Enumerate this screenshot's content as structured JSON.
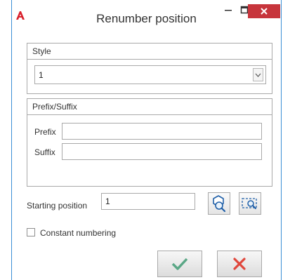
{
  "window": {
    "title": "Renumber position",
    "app_icon": "autocad-logo-icon",
    "controls": [
      "minimize-icon",
      "maximize-icon",
      "close-icon"
    ],
    "close_color": "#c7353c"
  },
  "style_group": {
    "header": "Style",
    "selected_value": "1"
  },
  "prefix_suffix_group": {
    "header": "Prefix/Suffix",
    "prefix_label": "Prefix",
    "prefix_value": "",
    "suffix_label": "Suffix",
    "suffix_value": ""
  },
  "starting_position": {
    "label": "Starting position",
    "value": "1",
    "pick_button_icon": "pick-object-icon",
    "zoom_button_icon": "zoom-window-icon"
  },
  "constant_numbering": {
    "label": "Constant numbering",
    "checked": false
  },
  "actions": {
    "ok_icon": "checkmark-icon",
    "ok_color": "#5aa786",
    "cancel_icon": "cross-icon",
    "cancel_color": "#e0473c"
  }
}
